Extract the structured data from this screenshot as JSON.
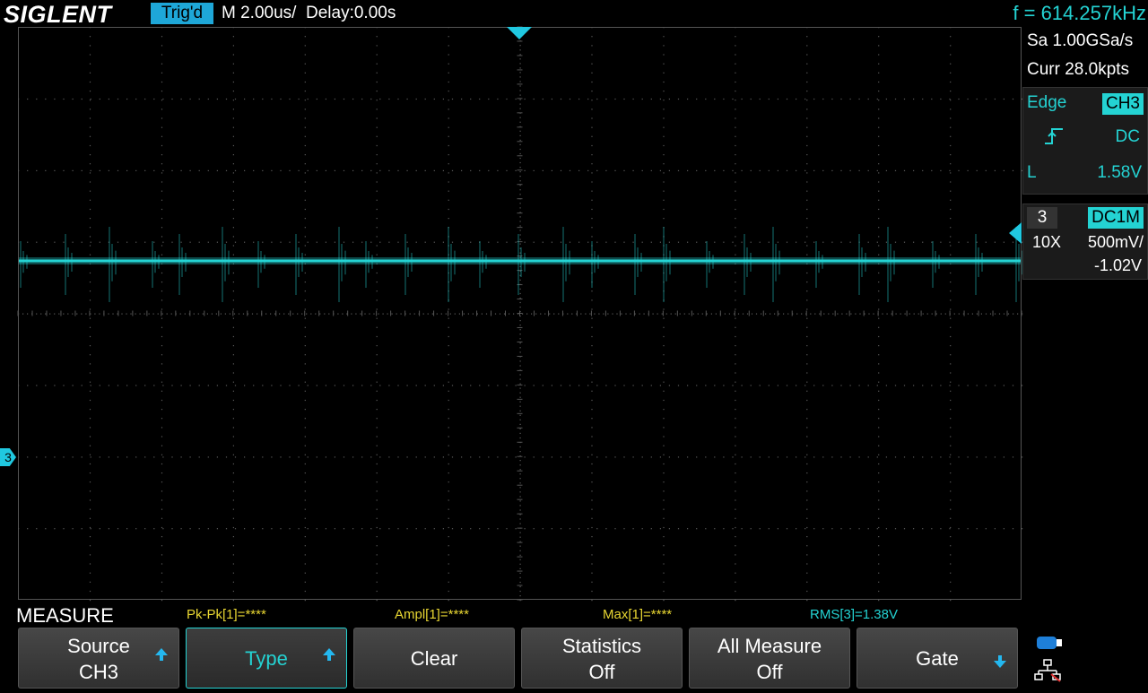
{
  "header": {
    "brand": "SIGLENT",
    "trigger_status": "Trig'd",
    "timebase": "M 2.00us/",
    "delay": "Delay:0.00s",
    "frequency": "f = 614.257kHz"
  },
  "acquisition": {
    "sample_rate": "Sa 1.00GSa/s",
    "memory_depth": "Curr 28.0kpts"
  },
  "trigger": {
    "type": "Edge",
    "source": "CH3",
    "slope": "rising-edge-icon",
    "coupling": "DC",
    "level_label": "L",
    "level": "1.58V"
  },
  "channel": {
    "number": "3",
    "coupling": "DC1M",
    "probe": "10X",
    "scale": "500mV/",
    "offset": "-1.02V",
    "marker": "3"
  },
  "measure": {
    "title": "MEASURE",
    "items": [
      {
        "label": "Pk-Pk[1]=****"
      },
      {
        "label": "Ampl[1]=****"
      },
      {
        "label": "Max[1]=****"
      },
      {
        "label": "RMS[3]=1.38V"
      }
    ]
  },
  "menu": {
    "source": {
      "line1": "Source",
      "line2": "CH3"
    },
    "type": {
      "label": "Type"
    },
    "clear": {
      "label": "Clear"
    },
    "statistics": {
      "line1": "Statistics",
      "line2": "Off"
    },
    "all_measure": {
      "line1": "All Measure",
      "line2": "Off"
    },
    "gate": {
      "label": "Gate"
    }
  },
  "colors": {
    "channel3": "#24d3d3",
    "measure_text": "#e8d632",
    "trig_badge": "#1ea7d8"
  }
}
